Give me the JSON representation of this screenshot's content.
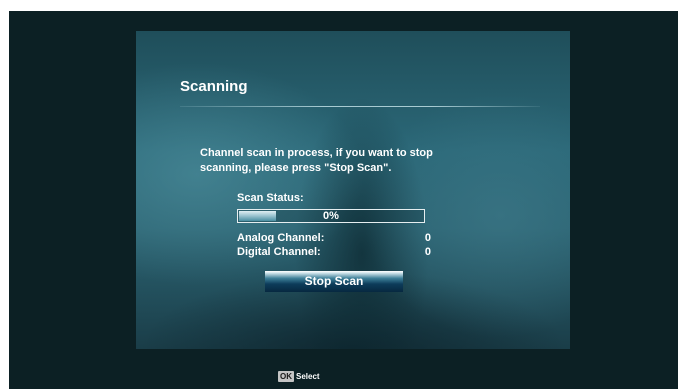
{
  "dialog": {
    "title": "Scanning",
    "message_line1": "Channel scan in process, if you want to stop",
    "message_line2": "scanning, please press \"Stop Scan\"."
  },
  "scan": {
    "status_label": "Scan Status:",
    "progress_text": "0%",
    "progress_fraction": 0.0,
    "analog_label": "Analog Channel:",
    "analog_value": "0",
    "digital_label": "Digital Channel:",
    "digital_value": "0"
  },
  "buttons": {
    "stop_scan": "Stop Scan"
  },
  "footer": {
    "ok_key": "OK",
    "select_label": "Select"
  },
  "colors": {
    "panel_teal": "#2b6878",
    "screen_background": "#0c2024",
    "text": "#ffffff"
  }
}
